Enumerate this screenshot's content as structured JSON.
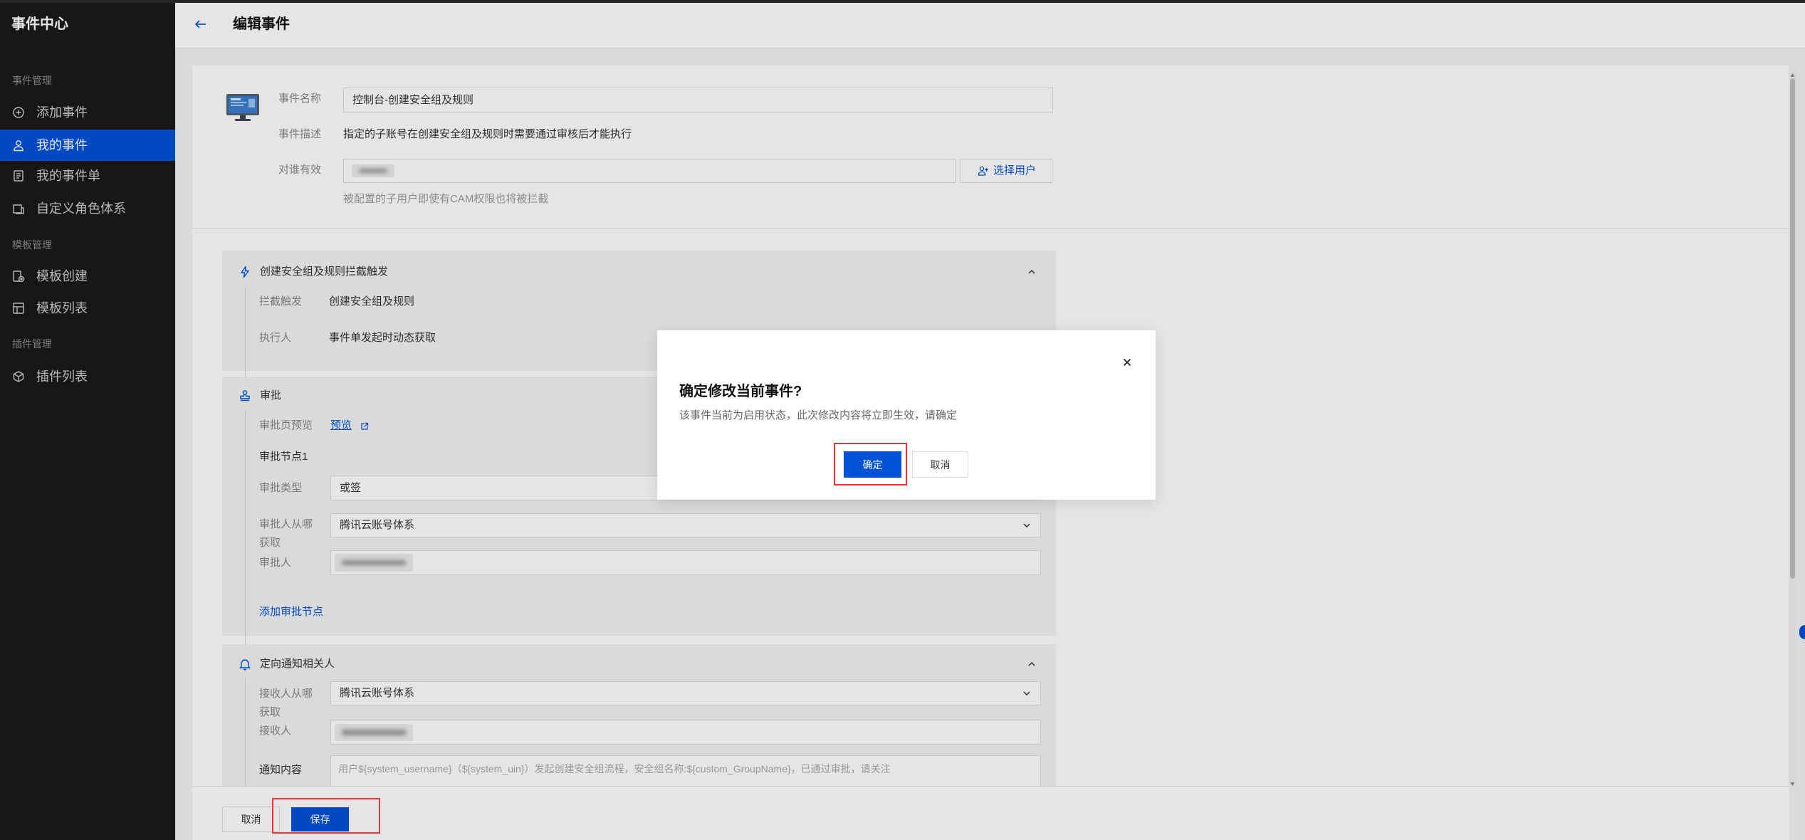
{
  "sidebar": {
    "title": "事件中心",
    "sections": [
      {
        "label": "事件管理",
        "items": [
          {
            "label": "添加事件",
            "icon": "add-circle-icon"
          },
          {
            "label": "我的事件",
            "icon": "user-icon",
            "active": true
          },
          {
            "label": "我的事件单",
            "icon": "ticket-icon"
          },
          {
            "label": "自定义角色体系",
            "icon": "role-system-icon"
          }
        ]
      },
      {
        "label": "模板管理",
        "items": [
          {
            "label": "模板创建",
            "icon": "template-create-icon"
          },
          {
            "label": "模板列表",
            "icon": "template-list-icon"
          }
        ]
      },
      {
        "label": "插件管理",
        "items": [
          {
            "label": "插件列表",
            "icon": "plugin-icon"
          }
        ]
      }
    ]
  },
  "header": {
    "back_icon": "arrow-left-icon",
    "title": "编辑事件"
  },
  "event": {
    "avatar_icon": "monitor-icon",
    "name": {
      "label": "事件名称",
      "value": "控制台-创建安全组及规则"
    },
    "description": {
      "label": "事件描述",
      "value": "指定的子账号在创建安全组及规则时需要通过审核后才能执行"
    },
    "scope": {
      "label": "对谁有效",
      "button_label": "选择用户",
      "button_icon": "user-add-icon",
      "hint": "被配置的子用户即使有CAM权限也将被拦截"
    }
  },
  "trigger": {
    "icon": "lightning-icon",
    "title": "创建安全组及规则拦截触发",
    "rows": [
      {
        "label": "拦截触发",
        "value": "创建安全组及规则"
      },
      {
        "label": "执行人",
        "value": "事件单发起时动态获取"
      }
    ]
  },
  "approval": {
    "icon": "stamp-icon",
    "title": "审批",
    "preview_label": "审批页预览",
    "preview_link": "预览",
    "node_title": "审批节点1",
    "type_label": "审批类型",
    "type_value": "或签",
    "source_label": "审批人从哪获取",
    "source_value": "腾讯云账号体系",
    "approver_label": "审批人",
    "add_node_link": "添加审批节点"
  },
  "notify": {
    "icon": "bell-icon",
    "title": "定向通知相关人",
    "source_label": "接收人从哪获取",
    "source_value": "腾讯云账号体系",
    "receiver_label": "接收人",
    "content_label": "通知内容",
    "content_value": "用户${system_username}（${system_uin}）发起创建安全组流程，安全组名称:${custom_GroupName}，已通过审批，请关注"
  },
  "footer": {
    "cancel_label": "取消",
    "save_label": "保存"
  },
  "modal": {
    "title": "确定修改当前事件?",
    "description": "该事件当前为启用状态，此次修改内容将立即生效，请确定",
    "confirm_label": "确定",
    "cancel_label": "取消",
    "close_icon": "close-icon"
  },
  "colors": {
    "brand_blue": "#0052d9",
    "highlight_red": "#e5383b",
    "sidebar_bg": "#1a1a1a"
  }
}
